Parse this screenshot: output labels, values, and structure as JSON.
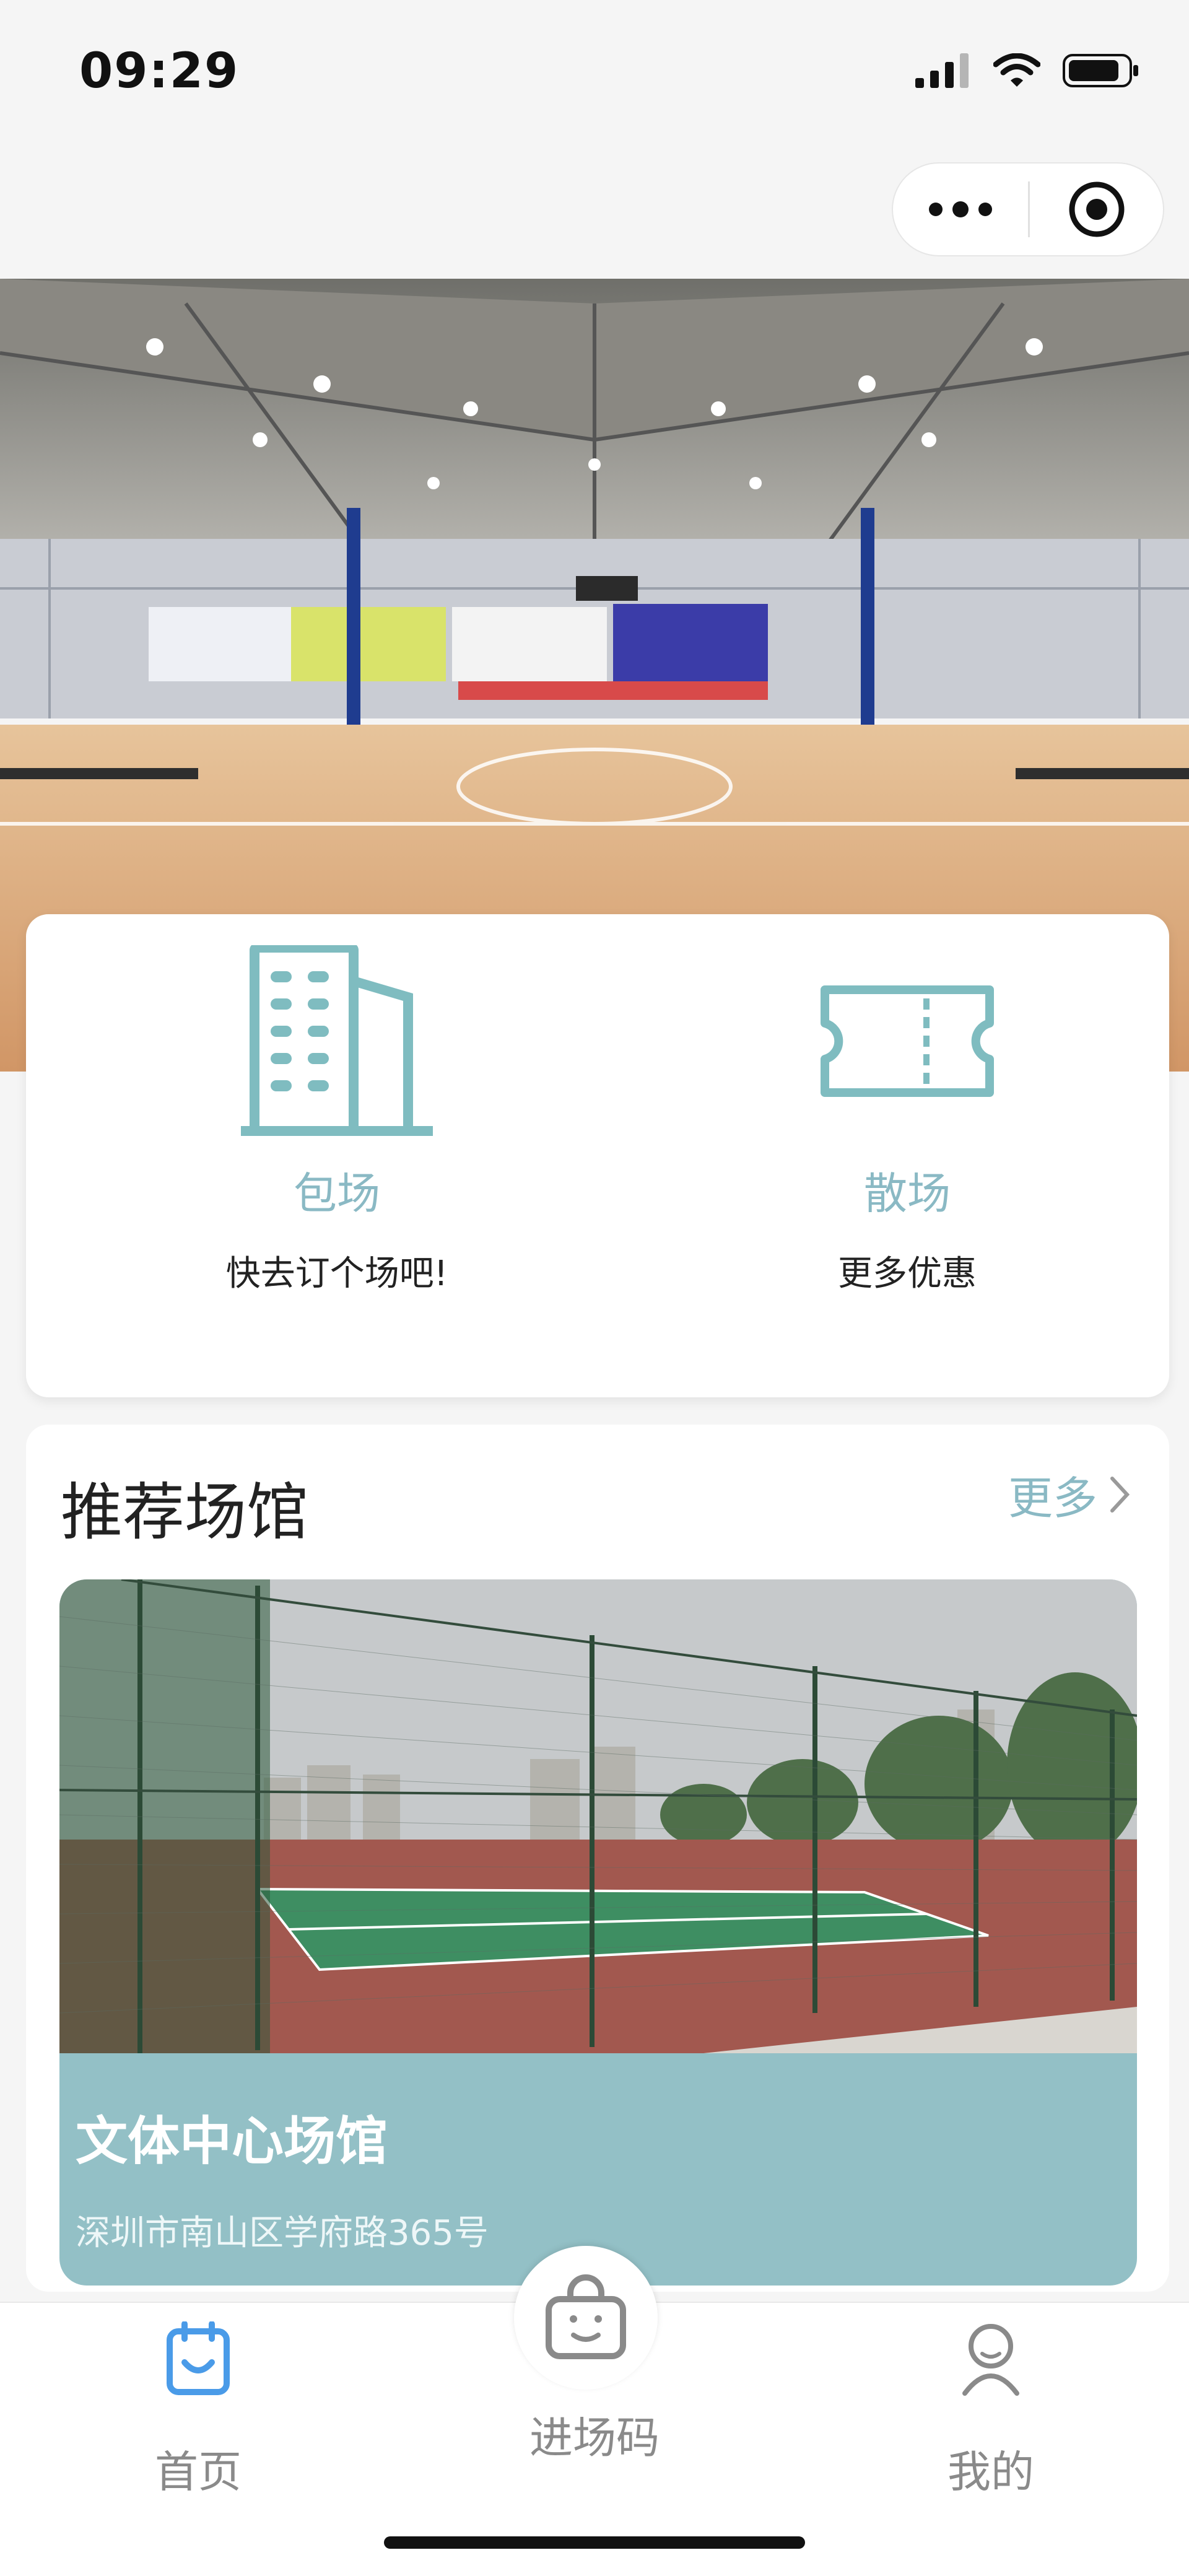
{
  "status_bar": {
    "time": "09:29"
  },
  "capsule": {
    "more_icon": "more-dots-icon",
    "close_icon": "target-circle-icon"
  },
  "banner": {
    "image": "indoor-basketball-court-photo"
  },
  "actions": [
    {
      "title": "包场",
      "subtitle": "快去订个场吧!",
      "icon": "building-icon"
    },
    {
      "title": "散场",
      "subtitle": "更多优惠",
      "icon": "ticket-icon"
    }
  ],
  "recommend": {
    "title": "推荐场馆",
    "more_label": "更多",
    "venue": {
      "name": "文体中心场馆",
      "address": "深圳市南山区学府路365号",
      "image": "outdoor-tennis-court-photo"
    }
  },
  "tabbar": {
    "items": [
      {
        "label": "首页",
        "icon": "home-calendar-icon"
      },
      {
        "label": "进场码",
        "icon": "shopping-bag-face-icon"
      },
      {
        "label": "我的",
        "icon": "user-icon"
      }
    ]
  },
  "colors": {
    "accent": "#8ab9c4",
    "venue_bg": "#93c0c6",
    "tab_active": "#4a9be8"
  }
}
